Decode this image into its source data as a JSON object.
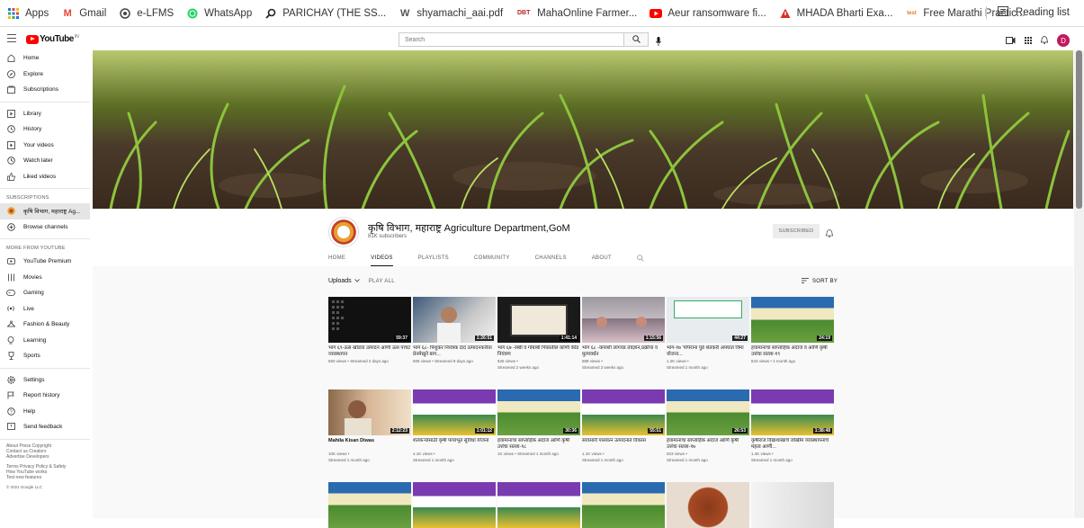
{
  "bookmarks": [
    {
      "icon": "apps-grid-icon",
      "label": "Apps"
    },
    {
      "icon": "gmail-icon",
      "label": "Gmail"
    },
    {
      "icon": "globe-icon",
      "label": "e-LFMS"
    },
    {
      "icon": "whatsapp-icon",
      "label": "WhatsApp"
    },
    {
      "icon": "search-icon",
      "label": "PARICHAY (THE SS..."
    },
    {
      "icon": "w-icon",
      "label": "shyamachi_aai.pdf"
    },
    {
      "icon": "dbt-icon",
      "label": "MahaOnline Farmer..."
    },
    {
      "icon": "youtube-icon",
      "label": "Aeur ransomware fi..."
    },
    {
      "icon": "warning-icon",
      "label": "MHADA Bharti Exa..."
    },
    {
      "icon": "test-icon",
      "label": "Free Marathi Practic..."
    }
  ],
  "reading_list": "Reading list",
  "header": {
    "logo_text": "YouTube",
    "logo_region": "IN",
    "search_placeholder": "Search",
    "avatar_letter": "D"
  },
  "sidebar": {
    "main": [
      "Home",
      "Explore",
      "Subscriptions"
    ],
    "library": [
      "Library",
      "History",
      "Your videos",
      "Watch later",
      "Liked videos"
    ],
    "subscriptions_heading": "SUBSCRIPTIONS",
    "subscriptions": [
      "कृषि विभाग, महाराष्ट्र Ag...",
      "Browse channels"
    ],
    "more_heading": "MORE FROM YOUTUBE",
    "more": [
      "YouTube Premium",
      "Movies",
      "Gaming",
      "Live",
      "Fashion & Beauty",
      "Learning",
      "Sports"
    ],
    "settings": [
      "Settings",
      "Report history",
      "Help",
      "Send feedback"
    ],
    "footer1": "About  Press  Copyright",
    "footer2": "Contact us  Creators",
    "footer3": "Advertise  Developers",
    "footer4": "Terms  Privacy  Policy & Safety",
    "footer5": "How YouTube works",
    "footer6": "Test new features",
    "footer7": "© 2021 Google LLC"
  },
  "channel": {
    "name": "कृषि विभाग, महाराष्ट्र Agriculture Department,GoM",
    "subscribers": "81K subscribers",
    "subscribed_label": "SUBSCRIBED",
    "tabs": [
      "HOME",
      "VIDEOS",
      "PLAYLISTS",
      "COMMUNITY",
      "CHANNELS",
      "ABOUT"
    ]
  },
  "uploads": {
    "label": "Uploads",
    "play_all": "PLAY ALL",
    "sort_by": "SORT BY"
  },
  "videos": [
    {
      "title": "भाग ६९-ऊस खोडवा उत्पादन आणी ऊस पाचट व्यवस्थापन",
      "meta1": "650 views • Streamed 2 days ago",
      "meta2": "",
      "duration": "59:37"
    },
    {
      "title": "भाग ६८- पिशुकर नियंत्रक दाद उत्पादनकरीता प्रेनमेखूने बाग...",
      "meta1": "605 views • Streamed 9 days ago",
      "meta2": "",
      "duration": "1:26:51"
    },
    {
      "title": "भाग ६७ -रब्बी व गोबाबी पिकांतील कोणी कीड नियंत्रण",
      "meta1": "825 views •",
      "meta2": "Streamed 2 weeks ago",
      "duration": "1:41:14"
    },
    {
      "title": "भाग ६८ -कपाशी लागवड तंत्रज्ञान,प्रक्रीया व मुल्यवर्धन",
      "meta1": "889 views •",
      "meta2": "Streamed 3 weeks ago",
      "duration": "1:15:56"
    },
    {
      "title": "भाग-१७ 'पोपेराना पुंडे शेतकरी अपघात विमा योजना...",
      "meta1": "1.2K views •",
      "meta2": "Streamed 1 month ago",
      "duration": "44:27"
    },
    {
      "title": "हवामानाचा साप्ताहिक अंदाज व आणि कृषी उत्तंचा सल्ला-१९",
      "meta1": "843 views • 1 month ago",
      "meta2": "",
      "duration": "24:19"
    },
    {
      "title": "Mahila Kisan Diwas",
      "meta1": "10K views •",
      "meta2": "Streamed 1 month ago",
      "duration": "2:12:23"
    },
    {
      "title": "शेतकऱ्यांसाठी कृषी पायाभूत सुविधा योजना",
      "meta1": "4.1K views •",
      "meta2": "Streamed 1 month ago",
      "duration": "1:01:12"
    },
    {
      "title": "हवामानाचा साप्ताहिक अंदाज आणि कृषी उत्तंचा सल्ला-१८",
      "meta1": "1K views • Streamed 1 month ago",
      "meta2": "",
      "duration": "30:36"
    },
    {
      "title": "सावसारी पासवत्न उत्पादनात विकास",
      "meta1": "1.1K views •",
      "meta2": "Streamed 1 month ago",
      "duration": "55:51"
    },
    {
      "title": "हवामानाचा साप्ताहिक अंदाज आणि कृषी उत्तंचा सल्ला-१७",
      "meta1": "923 views •",
      "meta2": "Streamed 1 month ago",
      "duration": "26:53"
    },
    {
      "title": "कृषीराज विद्याशाखांचे जोखीम व्यवस्थापनाचे महत्व आणी...",
      "meta1": "1.4K views •",
      "meta2": "Streamed 1 month ago",
      "duration": "1:38:48"
    },
    {
      "title": "",
      "meta1": "",
      "meta2": "",
      "duration": ""
    },
    {
      "title": "",
      "meta1": "",
      "meta2": "",
      "duration": ""
    },
    {
      "title": "",
      "meta1": "",
      "meta2": "",
      "duration": ""
    },
    {
      "title": "",
      "meta1": "",
      "meta2": "",
      "duration": ""
    },
    {
      "title": "",
      "meta1": "",
      "meta2": "",
      "duration": ""
    },
    {
      "title": "",
      "meta1": "",
      "meta2": "",
      "duration": ""
    }
  ]
}
